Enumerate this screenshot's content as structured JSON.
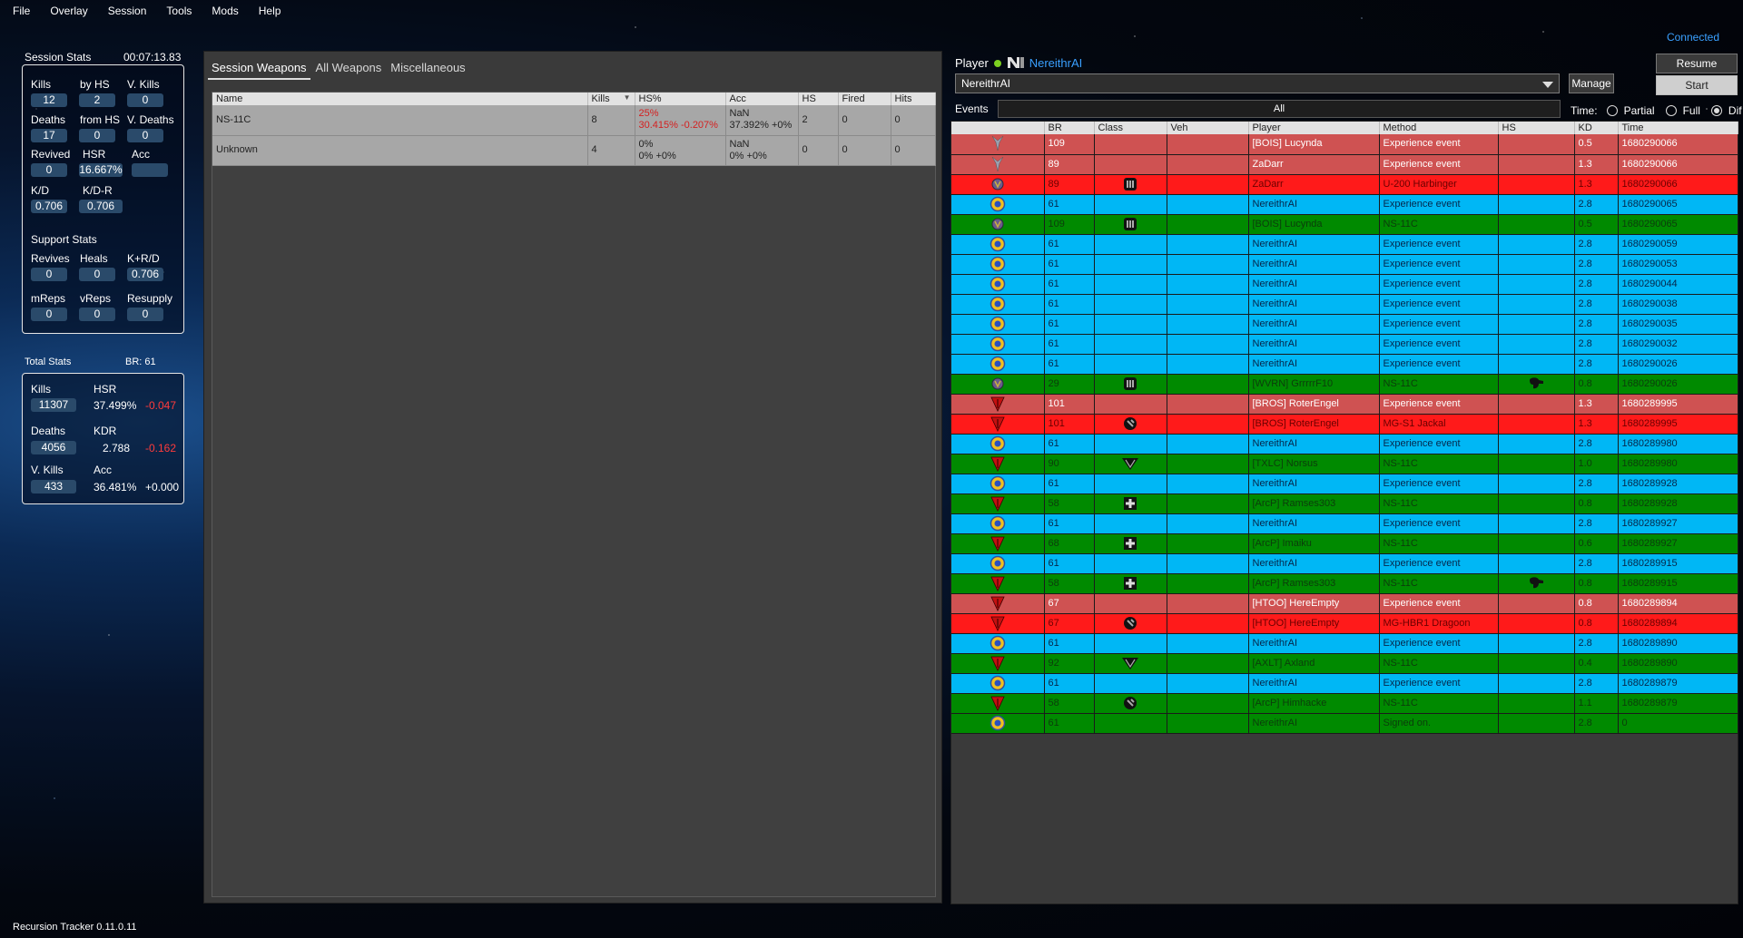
{
  "menu": [
    "File",
    "Overlay",
    "Session",
    "Tools",
    "Mods",
    "Help"
  ],
  "connection_status": "Connected",
  "session_stats": {
    "title": "Session Stats",
    "elapsed": "00:07:13.83",
    "kills_label": "Kills",
    "kills": "12",
    "byhs_label": "by HS",
    "byhs": "2",
    "vkills_label": "V. Kills",
    "vkills": "0",
    "deaths_label": "Deaths",
    "deaths": "17",
    "fromhs_label": "from HS",
    "fromhs": "0",
    "vdeaths_label": "V. Deaths",
    "vdeaths": "0",
    "revived_label": "Revived",
    "revived": "0",
    "hsr_label": "HSR",
    "hsr": "16.667%",
    "acc_label": "Acc",
    "acc": "",
    "kd_label": "K/D",
    "kd": "0.706",
    "kdr_label": "K/D-R",
    "kdr": "0.706",
    "support_title": "Support Stats",
    "revives_label": "Revives",
    "revives": "0",
    "heals_label": "Heals",
    "heals": "0",
    "krd_label": "K+R/D",
    "krd": "0.706",
    "mreps_label": "mReps",
    "mreps": "0",
    "vreps_label": "vReps",
    "vreps": "0",
    "resupply_label": "Resupply",
    "resupply": "0"
  },
  "total_stats": {
    "title": "Total Stats",
    "br": "BR: 61",
    "kills_label": "Kills",
    "kills": "11307",
    "hsr_label": "HSR",
    "hsr": "37.499%",
    "hsr_delta": "-0.047",
    "deaths_label": "Deaths",
    "deaths": "4056",
    "kdr_label": "KDR",
    "kdr": "2.788",
    "kdr_delta": "-0.162",
    "vkills_label": "V. Kills",
    "vkills": "433",
    "acc_label": "Acc",
    "acc": "36.481%",
    "acc_delta": "+0.000"
  },
  "weapons": {
    "tabs": [
      "Session Weapons",
      "All Weapons",
      "Miscellaneous"
    ],
    "columns": [
      "Name",
      "Kills",
      "HS%",
      "Acc",
      "HS",
      "Fired",
      "Hits"
    ],
    "rows": [
      {
        "name": "NS-11C",
        "kills": "8",
        "hs1": "25%",
        "hs2": "30.415%  -0.207%",
        "acc1": "NaN",
        "acc2": "37.392% +0%",
        "hs": "2",
        "fired": "0",
        "hits": "0"
      },
      {
        "name": "Unknown",
        "kills": "4",
        "hs1": "0%",
        "hs2": "0% +0%",
        "acc1": "NaN",
        "acc2": "0% +0%",
        "hs": "0",
        "fired": "0",
        "hits": "0"
      }
    ]
  },
  "player": {
    "label": "Player",
    "name": "NereithrAI",
    "selected": "NereithrAI",
    "manage_label": "Manage",
    "resume_label": "Resume",
    "start_label": "Start"
  },
  "events_filter": {
    "label": "Events",
    "value": "All"
  },
  "time_opts": {
    "label": "Time:",
    "partial": "Partial",
    "full": "Full",
    "dif": "Dif"
  },
  "event_columns": [
    "",
    "BR",
    "Class",
    "Veh",
    "Player",
    "Method",
    "HS",
    "KD",
    "Time"
  ],
  "events": [
    {
      "c": "lred",
      "fac": "nc",
      "br": "109",
      "cls": "",
      "player": "[BOIS] Lucynda",
      "method": "Experience event",
      "hs": "",
      "kd": "0.5",
      "time": "1680290066"
    },
    {
      "c": "lred",
      "fac": "nc",
      "br": "89",
      "cls": "",
      "player": "ZaDarr",
      "method": "Experience event",
      "hs": "",
      "kd": "1.3",
      "time": "1680290066"
    },
    {
      "c": "dred",
      "fac": "vs",
      "br": "89",
      "cls": "max",
      "player": "ZaDarr",
      "method": "U-200 Harbinger",
      "hs": "",
      "kd": "1.3",
      "time": "1680290066"
    },
    {
      "c": "blue",
      "fac": "ns",
      "br": "61",
      "cls": "",
      "player": "NereithrAI",
      "method": "Experience event",
      "hs": "",
      "kd": "2.8",
      "time": "1680290065"
    },
    {
      "c": "green",
      "fac": "vs",
      "br": "109",
      "cls": "max",
      "player": "[BOIS] Lucynda",
      "method": "NS-11C",
      "hs": "",
      "kd": "0.5",
      "time": "1680290065"
    },
    {
      "c": "blue",
      "fac": "ns",
      "br": "61",
      "cls": "",
      "player": "NereithrAI",
      "method": "Experience event",
      "hs": "",
      "kd": "2.8",
      "time": "1680290059"
    },
    {
      "c": "blue",
      "fac": "ns",
      "br": "61",
      "cls": "",
      "player": "NereithrAI",
      "method": "Experience event",
      "hs": "",
      "kd": "2.8",
      "time": "1680290053"
    },
    {
      "c": "blue",
      "fac": "ns",
      "br": "61",
      "cls": "",
      "player": "NereithrAI",
      "method": "Experience event",
      "hs": "",
      "kd": "2.8",
      "time": "1680290044"
    },
    {
      "c": "blue",
      "fac": "ns",
      "br": "61",
      "cls": "",
      "player": "NereithrAI",
      "method": "Experience event",
      "hs": "",
      "kd": "2.8",
      "time": "1680290038"
    },
    {
      "c": "blue",
      "fac": "ns",
      "br": "61",
      "cls": "",
      "player": "NereithrAI",
      "method": "Experience event",
      "hs": "",
      "kd": "2.8",
      "time": "1680290035"
    },
    {
      "c": "blue",
      "fac": "ns",
      "br": "61",
      "cls": "",
      "player": "NereithrAI",
      "method": "Experience event",
      "hs": "",
      "kd": "2.8",
      "time": "1680290032"
    },
    {
      "c": "blue",
      "fac": "ns",
      "br": "61",
      "cls": "",
      "player": "NereithrAI",
      "method": "Experience event",
      "hs": "",
      "kd": "2.8",
      "time": "1680290026"
    },
    {
      "c": "green",
      "fac": "vs",
      "br": "29",
      "cls": "max",
      "player": "[WVRN] GrrrrrF10",
      "method": "NS-11C",
      "hs": "hs",
      "kd": "0.8",
      "time": "1680290026"
    },
    {
      "c": "lred",
      "fac": "tr",
      "br": "101",
      "cls": "",
      "player": "[BROS] RoterEngel",
      "method": "Experience event",
      "hs": "",
      "kd": "1.3",
      "time": "1680289995"
    },
    {
      "c": "dred",
      "fac": "tr",
      "br": "101",
      "cls": "eng",
      "player": "[BROS] RoterEngel",
      "method": "MG-S1 Jackal",
      "hs": "",
      "kd": "1.3",
      "time": "1680289995"
    },
    {
      "c": "blue",
      "fac": "ns",
      "br": "61",
      "cls": "",
      "player": "NereithrAI",
      "method": "Experience event",
      "hs": "",
      "kd": "2.8",
      "time": "1680289980"
    },
    {
      "c": "green",
      "fac": "tr",
      "br": "90",
      "cls": "inf",
      "player": "[TXLC] Norsus",
      "method": "NS-11C",
      "hs": "",
      "kd": "1.0",
      "time": "1680289980"
    },
    {
      "c": "blue",
      "fac": "ns",
      "br": "61",
      "cls": "",
      "player": "NereithrAI",
      "method": "Experience event",
      "hs": "",
      "kd": "2.8",
      "time": "1680289928"
    },
    {
      "c": "green",
      "fac": "tr",
      "br": "58",
      "cls": "med",
      "player": "[ArcP] Ramses303",
      "method": "NS-11C",
      "hs": "",
      "kd": "0.8",
      "time": "1680289928"
    },
    {
      "c": "blue",
      "fac": "ns",
      "br": "61",
      "cls": "",
      "player": "NereithrAI",
      "method": "Experience event",
      "hs": "",
      "kd": "2.8",
      "time": "1680289927"
    },
    {
      "c": "green",
      "fac": "tr",
      "br": "68",
      "cls": "med",
      "player": "[ArcP] Imaiku",
      "method": "NS-11C",
      "hs": "",
      "kd": "0.6",
      "time": "1680289927"
    },
    {
      "c": "blue",
      "fac": "ns",
      "br": "61",
      "cls": "",
      "player": "NereithrAI",
      "method": "Experience event",
      "hs": "",
      "kd": "2.8",
      "time": "1680289915"
    },
    {
      "c": "green",
      "fac": "tr",
      "br": "58",
      "cls": "med",
      "player": "[ArcP] Ramses303",
      "method": "NS-11C",
      "hs": "hs",
      "kd": "0.8",
      "time": "1680289915"
    },
    {
      "c": "lred",
      "fac": "tr",
      "br": "67",
      "cls": "",
      "player": "[HTOO] HereEmpty",
      "method": "Experience event",
      "hs": "",
      "kd": "0.8",
      "time": "1680289894"
    },
    {
      "c": "dred",
      "fac": "tr",
      "br": "67",
      "cls": "eng",
      "player": "[HTOO] HereEmpty",
      "method": "MG-HBR1 Dragoon",
      "hs": "",
      "kd": "0.8",
      "time": "1680289894"
    },
    {
      "c": "blue",
      "fac": "ns",
      "br": "61",
      "cls": "",
      "player": "NereithrAI",
      "method": "Experience event",
      "hs": "",
      "kd": "2.8",
      "time": "1680289890"
    },
    {
      "c": "green",
      "fac": "tr",
      "br": "92",
      "cls": "inf",
      "player": "[AXLT] Axland",
      "method": "NS-11C",
      "hs": "",
      "kd": "0.4",
      "time": "1680289890"
    },
    {
      "c": "blue",
      "fac": "ns",
      "br": "61",
      "cls": "",
      "player": "NereithrAI",
      "method": "Experience event",
      "hs": "",
      "kd": "2.8",
      "time": "1680289879"
    },
    {
      "c": "green",
      "fac": "tr",
      "br": "58",
      "cls": "eng",
      "player": "[ArcP] Himhacke",
      "method": "NS-11C",
      "hs": "",
      "kd": "1.1",
      "time": "1680289879"
    },
    {
      "c": "green",
      "fac": "ns",
      "br": "61",
      "cls": "",
      "player": "NereithrAI",
      "method": "Signed on.",
      "hs": "",
      "kd": "2.8",
      "time": "0"
    }
  ],
  "status_bar": "Recursion Tracker 0.11.0.11",
  "colors": {
    "blue_row": "#00b7f5",
    "green_row": "#008a00",
    "red_row": "#ff1a1a",
    "lightred_row": "#cf5252",
    "accent": "#3aa0ff"
  }
}
